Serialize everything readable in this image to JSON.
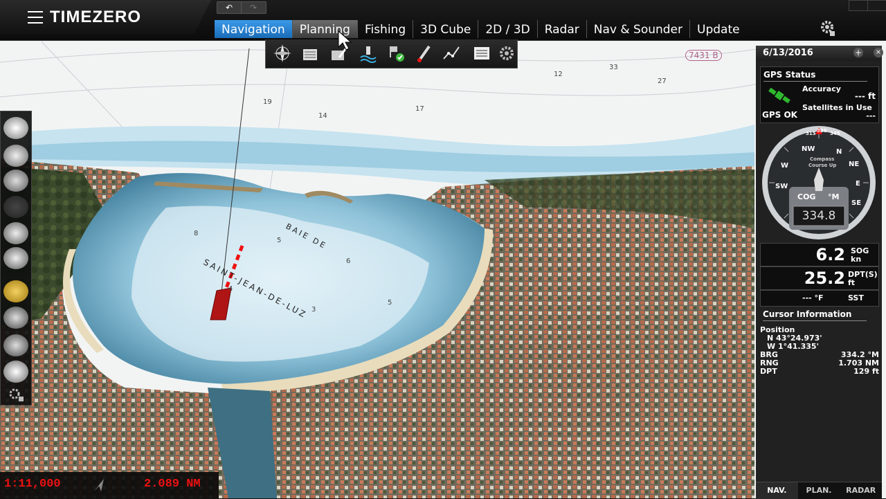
{
  "app": {
    "logo": "TIMEZERO"
  },
  "toolbar": {
    "undo": "↶",
    "redo": "↷"
  },
  "tabs": [
    {
      "label": "Navigation",
      "active": true
    },
    {
      "label": "Planning",
      "active": false
    },
    {
      "label": "Fishing",
      "active": false
    },
    {
      "label": "3D Cube",
      "active": false
    },
    {
      "label": "2D / 3D",
      "active": false
    },
    {
      "label": "Radar",
      "active": false
    },
    {
      "label": "Nav & Sounder",
      "active": false
    },
    {
      "label": "Update",
      "active": false
    }
  ],
  "ribbon_icons": [
    "compass-rose-icon",
    "route-book-icon",
    "route-pencil-icon",
    "buoy-icon",
    "route-flag-icon",
    "flare-icon",
    "boat-track-icon",
    "list-icon",
    "settings-icon"
  ],
  "map_labels": {
    "bay1": "BAIE DE",
    "bay2": "SAINT-JEAN-DE-LUZ",
    "chart_tag": "7431 B"
  },
  "panel": {
    "date": "6/13/2016",
    "gps": {
      "title": "GPS Status",
      "status": "GPS OK",
      "accuracy_label": "Accuracy",
      "accuracy_value": "--- ft",
      "satellites_label": "Satellites in Use",
      "satellites_value": "---"
    },
    "compass": {
      "cog_label": "COG",
      "unit": "°M",
      "cog_value": "334.8",
      "mode1": "Compass",
      "mode2": "Course Up",
      "heading_digits": [
        "330",
        "345",
        "315"
      ]
    },
    "sog": {
      "value": "6.2",
      "label": "SOG",
      "unit": "kn"
    },
    "depth": {
      "value": "25.2",
      "label": "DPT(S)",
      "unit": "ft"
    },
    "temp": {
      "value": "--- °F",
      "label": "SST"
    },
    "cursor": {
      "title": "Cursor Information",
      "position_label": "Position",
      "lat": "N 43°24.973'",
      "lon": "W 1°41.335'",
      "brg_label": "BRG",
      "brg_value": "334.2 °M",
      "rng_label": "RNG",
      "rng_value": "1.703 NM",
      "dpt_label": "DPT",
      "dpt_value": "129 ft"
    }
  },
  "bottom_tabs": [
    {
      "label": "NAV.",
      "active": true
    },
    {
      "label": "PLAN.",
      "active": false
    },
    {
      "label": "RADAR",
      "active": false
    }
  ],
  "status": {
    "scale": "1:11,000",
    "distance": "2.089 NM"
  },
  "colors": {
    "accent": "#2b86d6",
    "alert": "#e11111",
    "vessel": "#b01515"
  }
}
